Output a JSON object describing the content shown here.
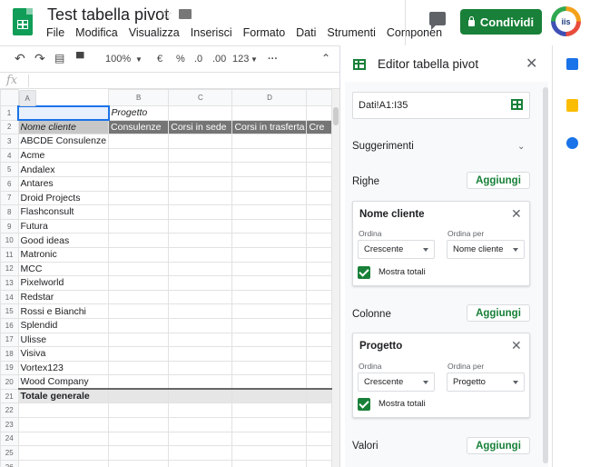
{
  "header": {
    "doc_title": "Test tabella pivot",
    "menus": [
      "File",
      "Modifica",
      "Visualizza",
      "Inserisci",
      "Formato",
      "Dati",
      "Strumenti",
      "Componen"
    ],
    "share_label": "Condividi"
  },
  "toolbar": {
    "zoom": "100%",
    "currency": "€",
    "percent": "%",
    "dec_less": ".0",
    "dec_more": ".00",
    "format": "123",
    "more": "···"
  },
  "formula_bar": {
    "fx": "fx"
  },
  "grid": {
    "col_headers": [
      "A",
      "B",
      "C",
      "D",
      ""
    ],
    "rows": [
      {
        "n": "1",
        "a": "",
        "b": "Progetto",
        "c": "",
        "d": "",
        "e": ""
      },
      {
        "n": "2",
        "a": "Nome cliente",
        "b": "Consulenze",
        "c": "Corsi in sede",
        "d": "Corsi in trasferta",
        "e": "Cre"
      },
      {
        "n": "3",
        "a": "ABCDE Consulenze"
      },
      {
        "n": "4",
        "a": "Acme"
      },
      {
        "n": "5",
        "a": "Andalex"
      },
      {
        "n": "6",
        "a": "Antares"
      },
      {
        "n": "7",
        "a": "Droid Projects"
      },
      {
        "n": "8",
        "a": "Flashconsult"
      },
      {
        "n": "9",
        "a": "Futura"
      },
      {
        "n": "10",
        "a": "Good ideas"
      },
      {
        "n": "11",
        "a": "Matronic"
      },
      {
        "n": "12",
        "a": "MCC"
      },
      {
        "n": "13",
        "a": "Pixelworld"
      },
      {
        "n": "14",
        "a": "Redstar"
      },
      {
        "n": "15",
        "a": "Rossi e Bianchi"
      },
      {
        "n": "16",
        "a": "Splendid"
      },
      {
        "n": "17",
        "a": "Ulisse"
      },
      {
        "n": "18",
        "a": "Visiva"
      },
      {
        "n": "19",
        "a": "Vortex123"
      },
      {
        "n": "20",
        "a": "Wood Company"
      },
      {
        "n": "21",
        "a": "Totale generale"
      },
      {
        "n": "22",
        "a": ""
      },
      {
        "n": "23",
        "a": ""
      },
      {
        "n": "24",
        "a": ""
      },
      {
        "n": "25",
        "a": ""
      },
      {
        "n": "26",
        "a": ""
      }
    ]
  },
  "panel": {
    "title": "Editor tabella pivot",
    "range": "Dati!A1:I35",
    "suggestions": "Suggerimenti",
    "rows_label": "Righe",
    "cols_label": "Colonne",
    "values_label": "Valori",
    "add_label": "Aggiungi",
    "row_card": {
      "title": "Nome cliente",
      "sort_label": "Ordina",
      "sort_value": "Crescente",
      "sortby_label": "Ordina per",
      "sortby_value": "Nome cliente",
      "totals": "Mostra totali"
    },
    "col_card": {
      "title": "Progetto",
      "sort_label": "Ordina",
      "sort_value": "Crescente",
      "sortby_label": "Ordina per",
      "sortby_value": "Progetto",
      "totals": "Mostra totali"
    }
  }
}
